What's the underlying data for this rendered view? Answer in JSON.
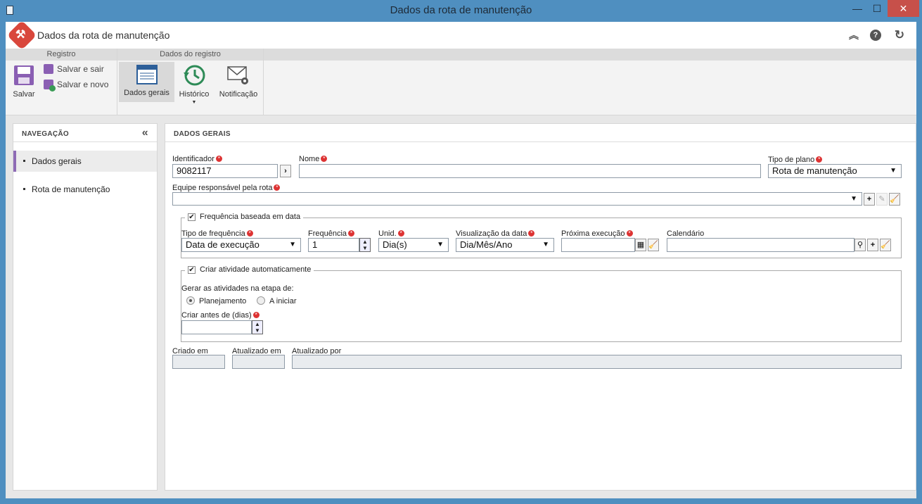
{
  "window": {
    "title": "Dados da rota de manutenção",
    "minimize": "—",
    "maximize": "☐",
    "close": "✕"
  },
  "app": {
    "title": "Dados da rota de manutenção"
  },
  "ribbon": {
    "group1": "Registro",
    "group2": "Dados do registro",
    "save": "Salvar",
    "save_exit": "Salvar e sair",
    "save_new": "Salvar e novo",
    "general": "Dados gerais",
    "history": "Histórico",
    "notification": "Notificação"
  },
  "nav": {
    "title": "NAVEGAÇÃO",
    "collapse": "«",
    "items": [
      {
        "label": "Dados gerais"
      },
      {
        "label": "Rota de manutenção"
      }
    ]
  },
  "main": {
    "title": "DADOS GERAIS",
    "identifier": {
      "label": "Identificador",
      "value": "9082117"
    },
    "name": {
      "label": "Nome",
      "value": ""
    },
    "plan_type": {
      "label": "Tipo de plano",
      "value": "Rota de manutenção"
    },
    "team": {
      "label": "Equipe responsável pela rota",
      "value": ""
    },
    "freq_section": {
      "legend": "Frequência baseada em data",
      "type": {
        "label": "Tipo de frequência",
        "value": "Data de execução"
      },
      "frequency": {
        "label": "Frequência",
        "value": "1"
      },
      "unit": {
        "label": "Unid.",
        "value": "Dia(s)"
      },
      "date_view": {
        "label": "Visualização da data",
        "value": "Dia/Mês/Ano"
      },
      "next_exec": {
        "label": "Próxima execução",
        "value": ""
      },
      "calendar": {
        "label": "Calendário",
        "value": ""
      }
    },
    "activity_section": {
      "legend": "Criar atividade automaticamente",
      "generate_label": "Gerar as atividades na etapa de:",
      "opt1": "Planejamento",
      "opt2": "A iniciar",
      "days_before": {
        "label": "Criar antes de (dias)",
        "value": ""
      }
    },
    "created": {
      "label": "Criado em",
      "value": ""
    },
    "updated": {
      "label": "Atualizado em",
      "value": ""
    },
    "updated_by": {
      "label": "Atualizado por",
      "value": ""
    }
  }
}
